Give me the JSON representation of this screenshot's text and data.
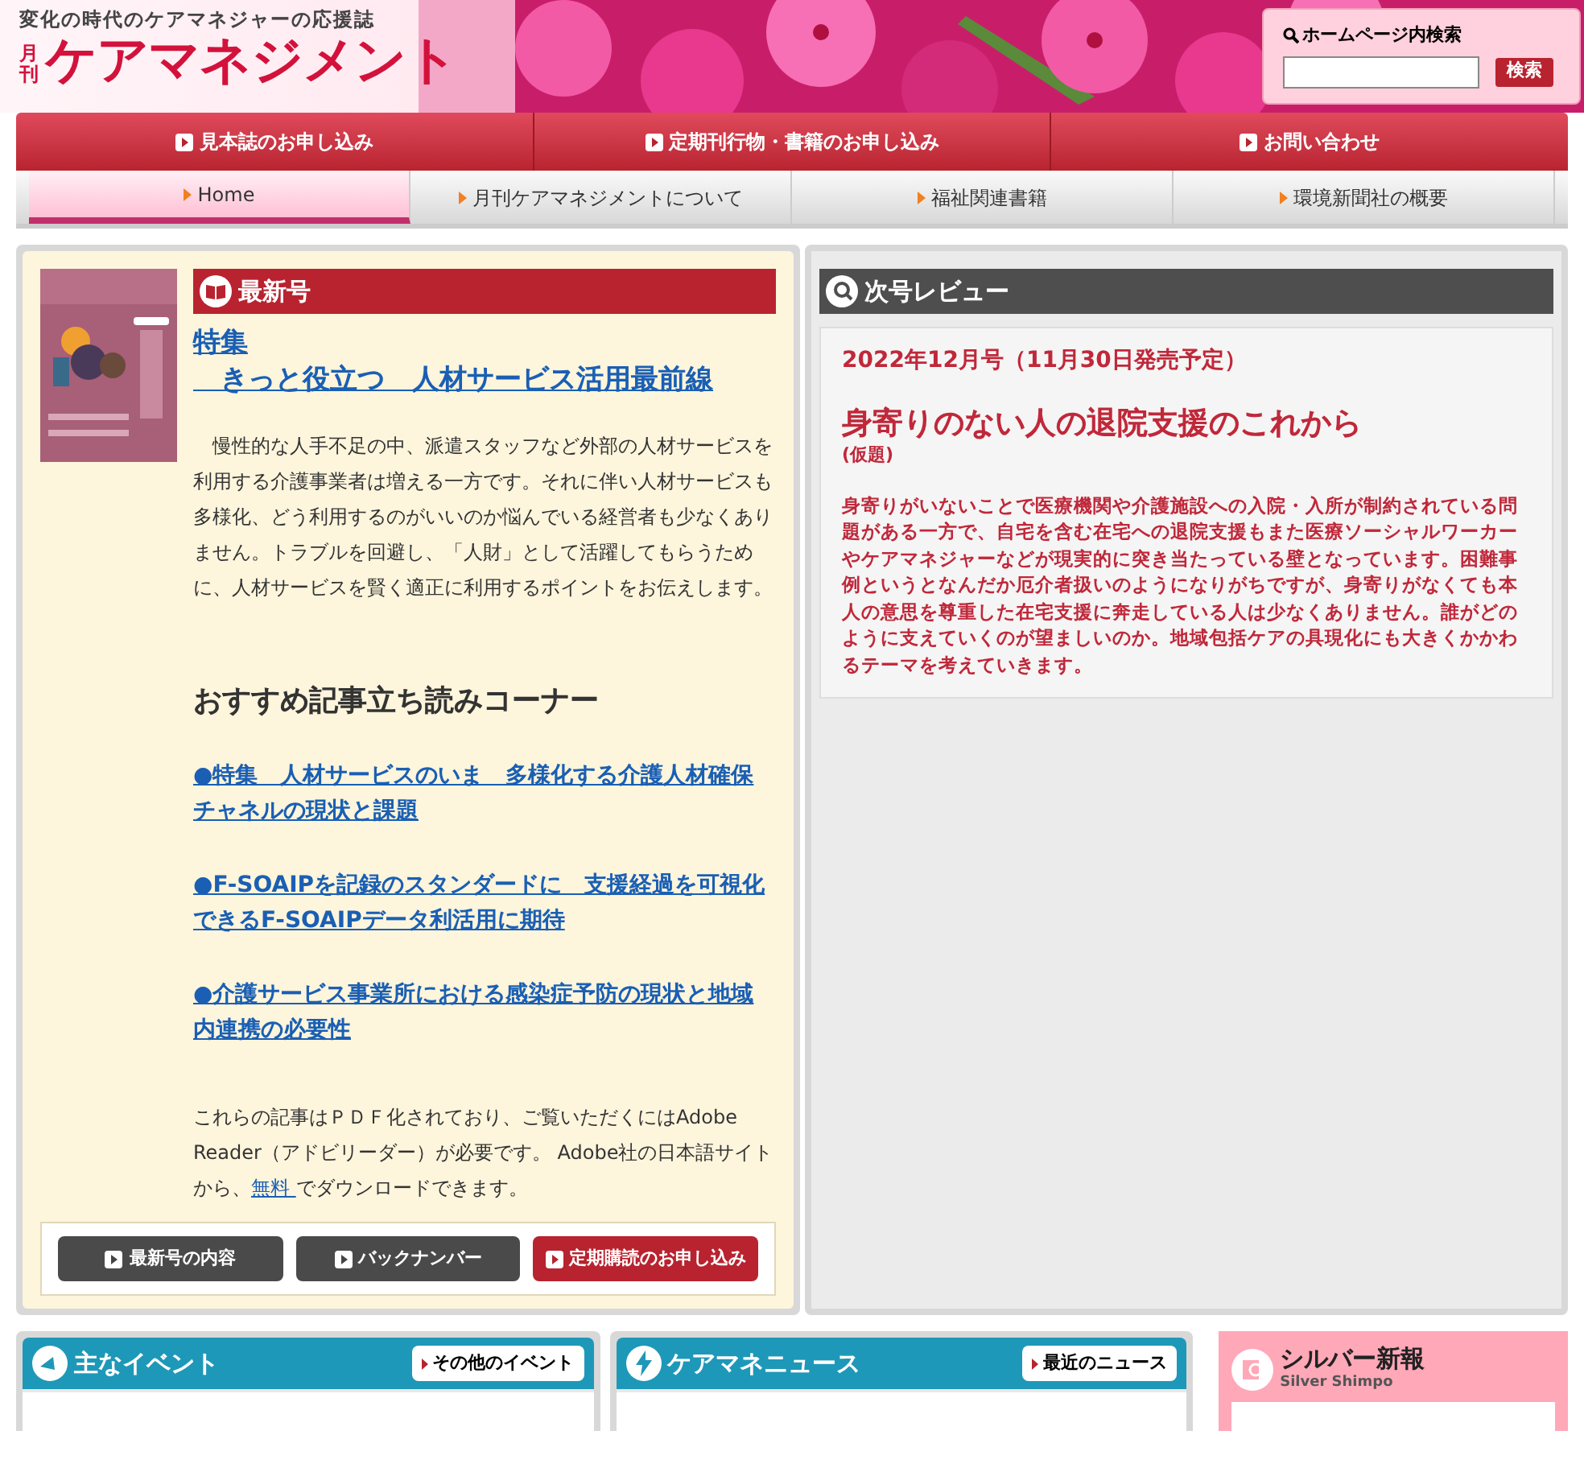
{
  "header": {
    "tagline": "変化の時代のケアマネジャーの応援誌",
    "logo_small": "月刊",
    "logo": "ケアマネジメント",
    "search": {
      "label": "ホームページ内検索",
      "button": "検索"
    }
  },
  "main_nav": [
    {
      "label": "見本誌のお申し込み"
    },
    {
      "label": "定期刊行物・書籍のお申し込み"
    },
    {
      "label": "お問い合わせ"
    }
  ],
  "sub_nav": [
    {
      "label": "Home",
      "selected": true
    },
    {
      "label": "月刊ケアマネジメントについて",
      "selected": false
    },
    {
      "label": "福祉関連書籍",
      "selected": false
    },
    {
      "label": "環境新聞社の概要",
      "selected": false
    }
  ],
  "latest_issue": {
    "heading": "最新号",
    "feature_title": "特集",
    "feature_subtitle": "　きっと役立つ　人材サービス活用最前線",
    "summary": "　慢性的な人手不足の中、派遣スタッフなど外部の人材サービスを利用する介護事業者は増える一方です。それに伴い人材サービスも多様化、どう利用するのがいいのか悩んでいる経営者も少なくありません。トラブルを回避し、「人財」として活躍してもらうために、人材サービスを賢く適正に利用するポイントをお伝えします。",
    "recommended_heading": "おすすめ記事立ち読みコーナー",
    "articles": [
      "●特集　人材サービスのいま　多様化する介護人材確保チャネルの現状と課題",
      "●F-SOAIPを記録のスタンダードに　支援経過を可視化できるF-SOAIPデータ利活用に期待",
      "●介護サービス事業所における感染症予防の現状と地域内連携の必要性"
    ],
    "pdf_note_before": "これらの記事はＰＤＦ化されており、ご覧いただくにはAdobe Reader（アドビリーダー）が必要です。 Adobe社の日本語サイトから、",
    "pdf_link": "無料 ",
    "pdf_note_after": "でダウンロードできます。",
    "buttons": [
      {
        "label": "最新号の内容",
        "kind": "dark"
      },
      {
        "label": "バックナンバー",
        "kind": "dark"
      },
      {
        "label": "定期購読のお申し込み",
        "kind": "red"
      }
    ]
  },
  "next_issue": {
    "heading": "次号レビュー",
    "date": "2022年12月号（11月30日発売予定）",
    "title": "身寄りのない人の退院支援のこれから",
    "title_note": "(仮題)",
    "body": "身寄りがいないことで医療機関や介護施設への入院・入所が制約されている問題がある一方で、自宅を含む在宅への退院支援もまた医療ソーシャルワーカーやケアマネジャーなどが現実的に突き当たっている壁となっています。困難事例というとなんだか厄介者扱いのようになりがちですが、身寄りがなくても本人の意思を尊重した在宅支援に奔走している人は少なくありません。誰がどのように支えていくのが望ましいのか。地域包括ケアの具現化にも大きくかかわるテーマを考えていきます。"
  },
  "bottom": [
    {
      "heading": "主なイベント",
      "link": "その他のイベント",
      "kind": "events"
    },
    {
      "heading": "ケアマネニュース",
      "link": "最近のニュース",
      "kind": "news"
    },
    {
      "heading": "シルバー新報",
      "subheading": "Silver Shimpo",
      "kind": "silver"
    }
  ]
}
